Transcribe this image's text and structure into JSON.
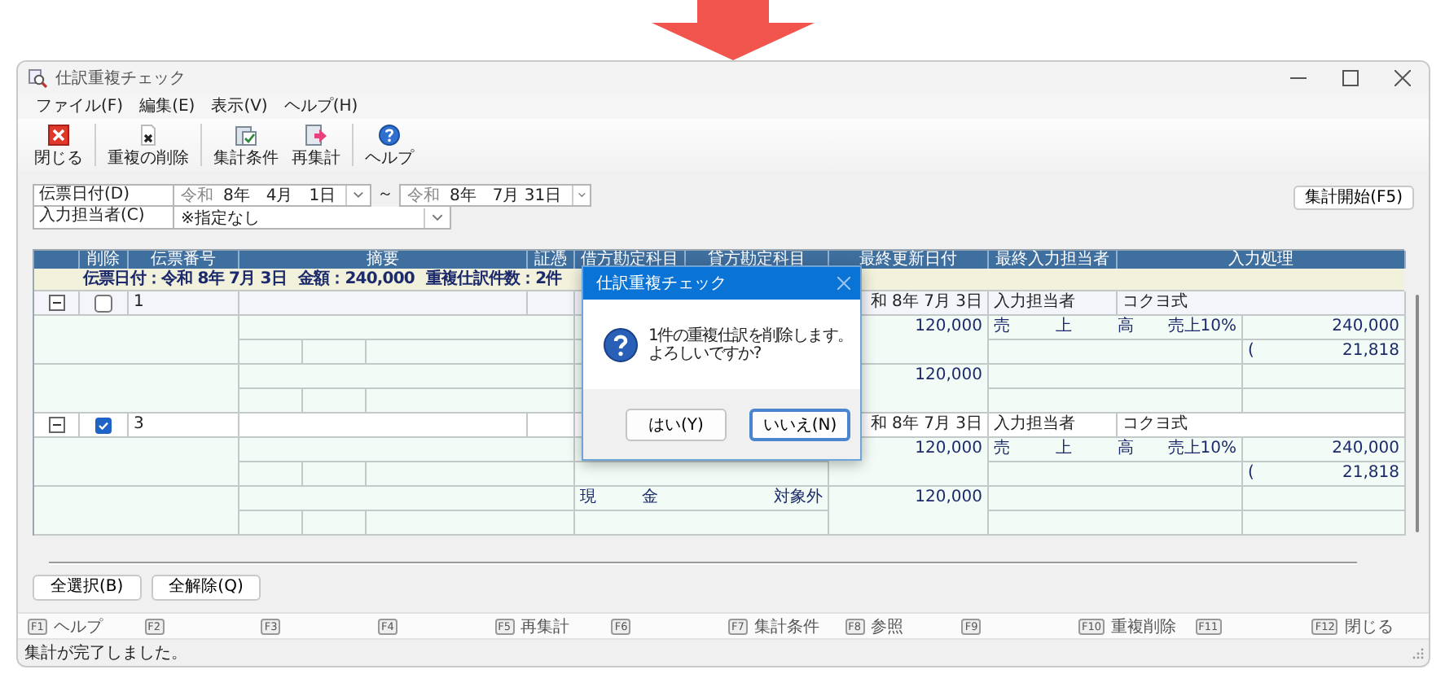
{
  "window": {
    "title": "仕訳重複チェック"
  },
  "menu": [
    "ファイル(F)",
    "編集(E)",
    "表示(V)",
    "ヘルプ(H)"
  ],
  "toolbar": [
    {
      "label": "閉じる",
      "kind": "close"
    },
    {
      "label": "重複の削除",
      "kind": "delete"
    },
    {
      "label": "集計条件",
      "kind": "conditions"
    },
    {
      "label": "再集計",
      "kind": "recalc"
    },
    {
      "label": "ヘルプ",
      "kind": "help"
    }
  ],
  "filters": {
    "date_label": "伝票日付(D)",
    "date_from": {
      "era": "令和",
      "date": "8年　4月　1日"
    },
    "range_sep": "～",
    "date_to": {
      "era": "令和",
      "date": "8年　7月 31日"
    },
    "user_label": "入力担当者(C)",
    "user_value": "※指定なし"
  },
  "start_button": "集計開始(F5)",
  "table": {
    "columns": [
      "削除",
      "伝票番号",
      "摘要",
      "証憑",
      "借方勘定科目",
      "貸方勘定科目",
      "最終更新日付",
      "最終入力担当者",
      "入力処理"
    ],
    "group_header": {
      "date": "伝票日付：令和 8年 7月 3日",
      "amount": "金額：240,000",
      "count": "重複仕訳件数：2件"
    },
    "entries": [
      {
        "number": "1",
        "checked": false,
        "expanded": true,
        "date": "和 8年 7月 3日",
        "user_label": "入力担当者",
        "user": "コクヨ式",
        "lines": [
          {
            "amount": "120,000",
            "credit_account": "売　上　高",
            "credit_tax": "売上10%",
            "credit_amount": "240,000",
            "tax_paren": "(",
            "tax_amount": "21,818"
          },
          {
            "amount": "120,000"
          }
        ]
      },
      {
        "number": "3",
        "checked": true,
        "expanded": true,
        "date": "和 8年 7月 3日",
        "user_label": "入力担当者",
        "user": "コクヨ式",
        "lines": [
          {
            "amount": "120,000",
            "credit_account": "売　上　高",
            "credit_tax": "売上10%",
            "credit_amount": "240,000",
            "tax_paren": "(",
            "tax_amount": "21,818"
          },
          {
            "debit_account": "現　金",
            "debit_tax": "対象外",
            "amount": "120,000"
          }
        ]
      }
    ]
  },
  "bottom_buttons": [
    "全選択(B)",
    "全解除(Q)"
  ],
  "function_keys": [
    {
      "key": "F1",
      "label": "ヘルプ"
    },
    {
      "key": "F2"
    },
    {
      "key": "F3"
    },
    {
      "key": "F4"
    },
    {
      "key": "F5",
      "label": "再集計"
    },
    {
      "key": "F6"
    },
    {
      "key": "F7",
      "label": "集計条件"
    },
    {
      "key": "F8",
      "label": "参照"
    },
    {
      "key": "F9"
    },
    {
      "key": "F10",
      "label": "重複削除"
    },
    {
      "key": "F11"
    },
    {
      "key": "F12",
      "label": "閉じる"
    }
  ],
  "status_bar": "集計が完了しました。",
  "dialog": {
    "title": "仕訳重複チェック",
    "message": [
      "1件の重複仕訳を削除します。",
      "よろしいですか?"
    ],
    "buttons": [
      {
        "label": "はい(Y)",
        "focused": false
      },
      {
        "label": "いいえ(N)",
        "focused": true
      }
    ]
  }
}
